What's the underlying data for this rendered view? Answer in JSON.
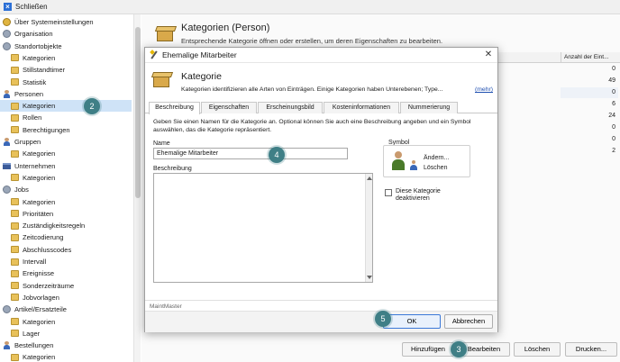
{
  "topbar": {
    "close_label": "Schließen"
  },
  "sidebar": {
    "items": [
      {
        "label": "Über Systemeinstellungen",
        "icon": "wrench-icon",
        "indent": 0
      },
      {
        "label": "Organisation",
        "icon": "gear-icon",
        "indent": 0
      },
      {
        "label": "Standortobjekte",
        "icon": "gear-icon",
        "indent": 0
      },
      {
        "label": "Kategorien",
        "icon": "folder-icon",
        "indent": 1
      },
      {
        "label": "Stillstandtimer",
        "icon": "folder-icon",
        "indent": 1
      },
      {
        "label": "Statistik",
        "icon": "folder-icon",
        "indent": 1
      },
      {
        "label": "Personen",
        "icon": "person-icon",
        "indent": 0
      },
      {
        "label": "Kategorien",
        "icon": "folder-icon",
        "indent": 1,
        "selected": true
      },
      {
        "label": "Rollen",
        "icon": "folder-icon",
        "indent": 1
      },
      {
        "label": "Berechtigungen",
        "icon": "folder-icon",
        "indent": 1
      },
      {
        "label": "Gruppen",
        "icon": "group-icon",
        "indent": 0
      },
      {
        "label": "Kategorien",
        "icon": "folder-icon",
        "indent": 1
      },
      {
        "label": "Unternehmen",
        "icon": "company-icon",
        "indent": 0
      },
      {
        "label": "Kategorien",
        "icon": "folder-icon",
        "indent": 1
      },
      {
        "label": "Jobs",
        "icon": "gear-icon",
        "indent": 0
      },
      {
        "label": "Kategorien",
        "icon": "folder-icon",
        "indent": 1
      },
      {
        "label": "Prioritäten",
        "icon": "folder-icon",
        "indent": 1
      },
      {
        "label": "Zuständigkeitsregeln",
        "icon": "folder-icon",
        "indent": 1
      },
      {
        "label": "Zeitcodierung",
        "icon": "folder-icon",
        "indent": 1
      },
      {
        "label": "Abschlusscodes",
        "icon": "folder-icon",
        "indent": 1
      },
      {
        "label": "Intervall",
        "icon": "folder-icon",
        "indent": 1
      },
      {
        "label": "Ereignisse",
        "icon": "folder-icon",
        "indent": 1
      },
      {
        "label": "Sonderzeiträume",
        "icon": "folder-icon",
        "indent": 1
      },
      {
        "label": "Jobvorlagen",
        "icon": "folder-icon",
        "indent": 1
      },
      {
        "label": "Artikel/Ersatzteile",
        "icon": "gear-icon",
        "indent": 0
      },
      {
        "label": "Kategorien",
        "icon": "folder-icon",
        "indent": 1
      },
      {
        "label": "Lager",
        "icon": "folder-icon",
        "indent": 1
      },
      {
        "label": "Bestellungen",
        "icon": "person-icon",
        "indent": 0
      },
      {
        "label": "Kategorien",
        "icon": "folder-icon",
        "indent": 1
      }
    ]
  },
  "main": {
    "title": "Kategorien (Person)",
    "subtitle": "Entsprechende Kategorie öffnen oder erstellen, um deren Eigenschaften zu bearbeiten.",
    "count_header": "Anzahl der Eint...",
    "counts": [
      "0",
      "49",
      "0",
      "6",
      "24",
      "0",
      "0",
      "2"
    ],
    "buttons": {
      "add": "Hinzufügen",
      "edit": "Bearbeiten",
      "delete": "Löschen",
      "print": "Drucken..."
    }
  },
  "dialog": {
    "window_title": "Ehemalige Mitarbeiter",
    "header_title": "Kategorie",
    "header_sub": "Kategorien identifizieren alle Arten von Einträgen. Einige Kategorien haben Unterebenen; Type...",
    "header_link": "(mehr)",
    "tabs": [
      "Beschreibung",
      "Eigenschaften",
      "Erscheinungsbild",
      "Kosteninformationen",
      "Nummerierung"
    ],
    "description": "Geben Sie einen Namen für die Kategorie an. Optional können Sie auch eine Beschreibung angeben und ein Symbol auswählen, das die Kategorie repräsentiert.",
    "name_label": "Name",
    "name_value": "Ehemalige Mitarbeiter",
    "beschreibung_label": "Beschreibung",
    "symbol_label": "Symbol",
    "symbol_change": "Ändern...",
    "symbol_delete": "Löschen",
    "deactivate_label": "Diese Kategorie deaktivieren",
    "footer_label": "MaintMaster",
    "ok": "OK",
    "cancel": "Abbrechen"
  },
  "steps": [
    "2",
    "3",
    "4",
    "5"
  ],
  "colors": {
    "step_marker": "#3f7f86",
    "selection": "#cfe3f7",
    "link": "#1f4fb0"
  }
}
